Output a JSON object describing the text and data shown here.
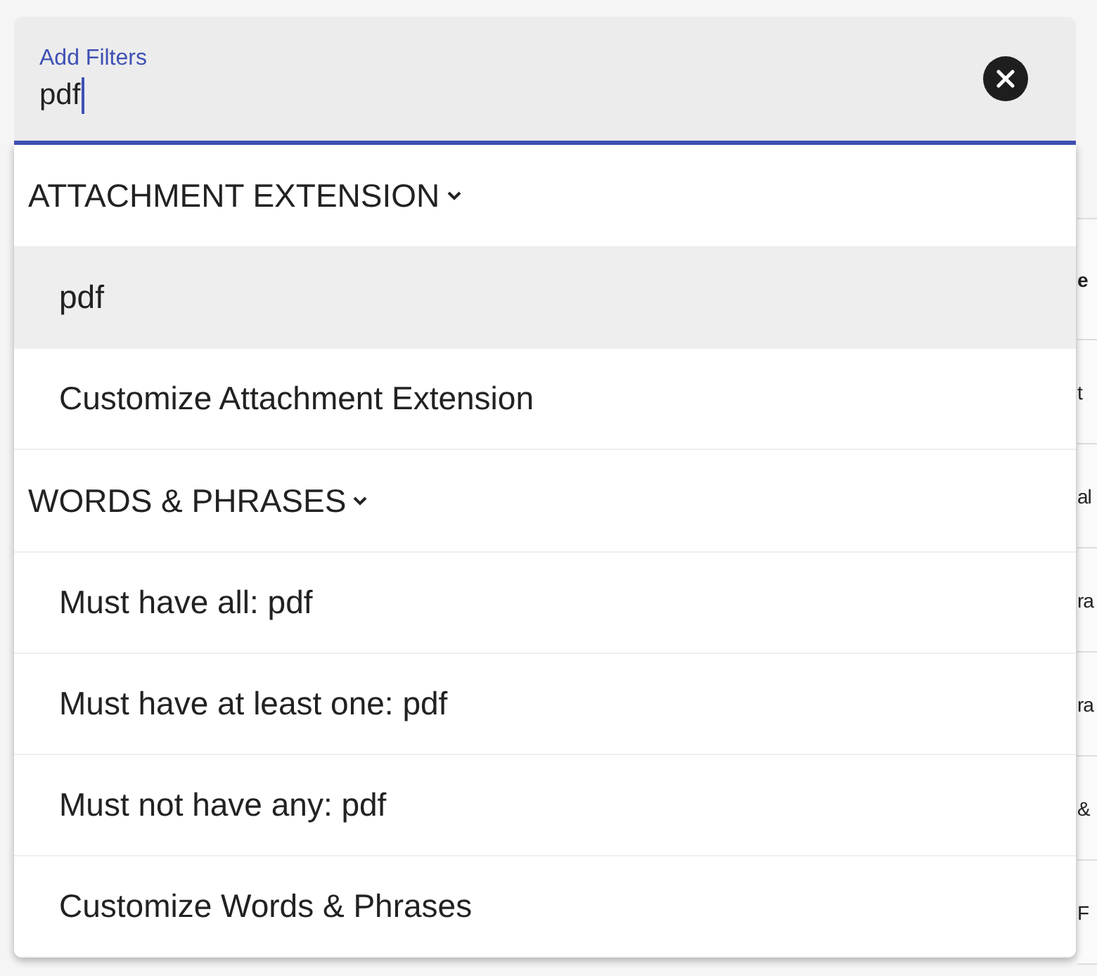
{
  "filter_field": {
    "label": "Add Filters",
    "value": "pdf"
  },
  "menu": {
    "sections": [
      {
        "title": "ATTACHMENT EXTENSION",
        "expanded": true,
        "items": [
          {
            "label": "pdf",
            "selected": true
          },
          {
            "label": "Customize Attachment Extension",
            "selected": false
          }
        ]
      },
      {
        "title": "WORDS & PHRASES",
        "expanded": true,
        "items": [
          {
            "label": "Must have all: pdf",
            "selected": false
          },
          {
            "label": "Must have at least one: pdf",
            "selected": false
          },
          {
            "label": "Must not have any: pdf",
            "selected": false
          },
          {
            "label": "Customize Words & Phrases",
            "selected": false
          }
        ]
      }
    ]
  },
  "background_table": {
    "column_header": "e",
    "cells": [
      "t",
      "al",
      "ra",
      "ra",
      "&",
      "F"
    ]
  }
}
